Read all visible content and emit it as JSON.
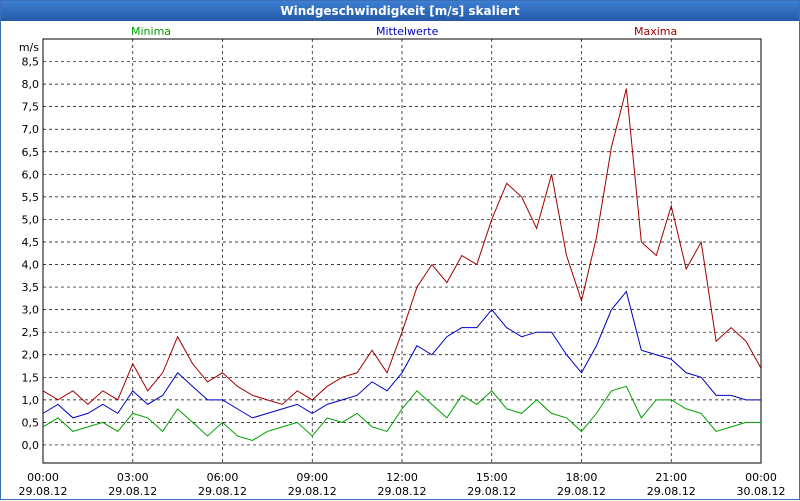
{
  "window": {
    "title": "Windgeschwindigkeit [m/s] skaliert"
  },
  "legend": {
    "min": "Minima",
    "mean": "Mittelwerte",
    "max": "Maxima"
  },
  "colors": {
    "min": "#00a000",
    "mean": "#0000c0",
    "max": "#a00000",
    "title_bg": "#2f6bc0",
    "grid": "#000000"
  },
  "chart_data": {
    "type": "line",
    "title": "Windgeschwindigkeit [m/s] skaliert",
    "ylabel": "m/s",
    "ylim": [
      -0.4,
      9.0
    ],
    "y_ticks": [
      "0,0",
      "0,5",
      "1,0",
      "1,5",
      "2,0",
      "2,5",
      "3,0",
      "3,5",
      "4,0",
      "4,5",
      "5,0",
      "5,5",
      "6,0",
      "6,5",
      "7,0",
      "7,5",
      "8,0",
      "8,5"
    ],
    "x_ticks": [
      {
        "time": "00:00",
        "date": "29.08.12"
      },
      {
        "time": "03:00",
        "date": "29.08.12"
      },
      {
        "time": "06:00",
        "date": "29.08.12"
      },
      {
        "time": "09:00",
        "date": "29.08.12"
      },
      {
        "time": "12:00",
        "date": "29.08.12"
      },
      {
        "time": "15:00",
        "date": "29.08.12"
      },
      {
        "time": "18:00",
        "date": "29.08.12"
      },
      {
        "time": "21:00",
        "date": "29.08.12"
      },
      {
        "time": "00:00",
        "date": "30.08.12"
      }
    ],
    "x_hours": [
      0,
      0.5,
      1,
      1.5,
      2,
      2.5,
      3,
      3.5,
      4,
      4.5,
      5,
      5.5,
      6,
      6.5,
      7,
      7.5,
      8,
      8.5,
      9,
      9.5,
      10,
      10.5,
      11,
      11.5,
      12,
      12.5,
      13,
      13.5,
      14,
      14.5,
      15,
      15.5,
      16,
      16.5,
      17,
      17.5,
      18,
      18.5,
      19,
      19.5,
      20,
      20.5,
      21,
      21.5,
      22,
      22.5,
      23,
      23.5,
      24
    ],
    "series": [
      {
        "name": "Maxima",
        "values": [
          1.2,
          1.0,
          1.2,
          0.9,
          1.2,
          1.0,
          1.8,
          1.2,
          1.6,
          2.4,
          1.8,
          1.4,
          1.6,
          1.3,
          1.1,
          1.0,
          0.9,
          1.2,
          1.0,
          1.3,
          1.5,
          1.6,
          2.1,
          1.6,
          2.5,
          3.5,
          4.0,
          3.6,
          4.2,
          4.0,
          5.0,
          5.8,
          5.5,
          4.8,
          6.0,
          4.2,
          3.2,
          4.6,
          6.6,
          7.9,
          4.5,
          4.2,
          5.3,
          3.9,
          4.5,
          2.3,
          2.6,
          2.3,
          1.7
        ],
        "fine": "max"
      },
      {
        "name": "Mittelwerte",
        "values": [
          0.7,
          0.9,
          0.6,
          0.7,
          0.9,
          0.7,
          1.2,
          0.9,
          1.1,
          1.6,
          1.3,
          1.0,
          1.0,
          0.8,
          0.6,
          0.7,
          0.8,
          0.9,
          0.7,
          0.9,
          1.0,
          1.1,
          1.4,
          1.2,
          1.6,
          2.2,
          2.0,
          2.4,
          2.6,
          2.6,
          3.0,
          2.6,
          2.4,
          2.5,
          2.5,
          2.0,
          1.6,
          2.2,
          3.0,
          3.4,
          2.1,
          2.0,
          1.9,
          1.6,
          1.5,
          1.1,
          1.1,
          1.0,
          1.0
        ]
      },
      {
        "name": "Minima",
        "values": [
          0.4,
          0.6,
          0.3,
          0.4,
          0.5,
          0.3,
          0.7,
          0.6,
          0.3,
          0.8,
          0.5,
          0.2,
          0.5,
          0.2,
          0.1,
          0.3,
          0.4,
          0.5,
          0.2,
          0.6,
          0.5,
          0.7,
          0.4,
          0.3,
          0.8,
          1.2,
          0.9,
          0.6,
          1.1,
          0.9,
          1.2,
          0.8,
          0.7,
          1.0,
          0.7,
          0.6,
          0.3,
          0.7,
          1.2,
          1.3,
          0.6,
          1.0,
          1.0,
          0.8,
          0.7,
          0.3,
          0.4,
          0.5,
          0.5
        ]
      }
    ],
    "grid": true,
    "legend_placement": "top"
  }
}
